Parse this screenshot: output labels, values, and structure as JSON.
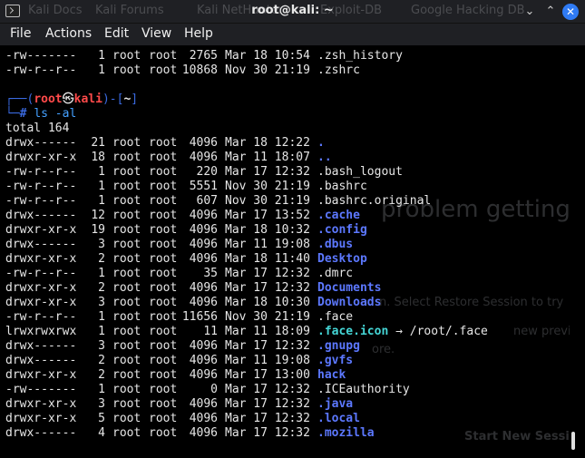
{
  "window": {
    "title": "root@kali: ~",
    "ghost_tabs": [
      "Kali Docs",
      "Kali Forums",
      "Kali NetHunter",
      "Exploit-DB",
      "Google Hacking DB"
    ],
    "controls": {
      "minimize": "⌄",
      "maximize": "⌃",
      "close": "✕"
    }
  },
  "menu": [
    "File",
    "Actions",
    "Edit",
    "View",
    "Help"
  ],
  "ghost_text": {
    "headline": "problem getting you",
    "restore": "n. Select Restore Session to try",
    "previous": "new previous",
    "more": "ore.",
    "start_new": "Start New Session"
  },
  "prev_lines": [
    {
      "perm": "-rw-------",
      "links": "1",
      "owner": "root",
      "group": "root",
      "size": "2765",
      "date": "Mar 18 10:54",
      "name": ".zsh_history",
      "kind": "file"
    },
    {
      "perm": "-rw-r--r--",
      "links": "1",
      "owner": "root",
      "group": "root",
      "size": "10868",
      "date": "Nov 30 21:19",
      "name": ".zshrc",
      "kind": "file"
    }
  ],
  "prompt": {
    "frame_top": "┌──(",
    "user": "root",
    "at": "㉿",
    "host": "kali",
    "mid": ")-[",
    "dir": "~",
    "end": "]",
    "frame_bottom": "└─",
    "hash": "#",
    "command": "ls -al"
  },
  "total": "total 164",
  "entries": [
    {
      "perm": "drwx------",
      "links": "21",
      "owner": "root",
      "group": "root",
      "size": "4096",
      "date": "Mar 18 12:22",
      "name": ".",
      "kind": "dir"
    },
    {
      "perm": "drwxr-xr-x",
      "links": "18",
      "owner": "root",
      "group": "root",
      "size": "4096",
      "date": "Mar 11 18:07",
      "name": "..",
      "kind": "dir"
    },
    {
      "perm": "-rw-r--r--",
      "links": "1",
      "owner": "root",
      "group": "root",
      "size": "220",
      "date": "Mar 17 12:32",
      "name": ".bash_logout",
      "kind": "file"
    },
    {
      "perm": "-rw-r--r--",
      "links": "1",
      "owner": "root",
      "group": "root",
      "size": "5551",
      "date": "Nov 30 21:19",
      "name": ".bashrc",
      "kind": "file"
    },
    {
      "perm": "-rw-r--r--",
      "links": "1",
      "owner": "root",
      "group": "root",
      "size": "607",
      "date": "Nov 30 21:19",
      "name": ".bashrc.original",
      "kind": "file"
    },
    {
      "perm": "drwx------",
      "links": "12",
      "owner": "root",
      "group": "root",
      "size": "4096",
      "date": "Mar 17 13:52",
      "name": ".cache",
      "kind": "dir"
    },
    {
      "perm": "drwxr-xr-x",
      "links": "19",
      "owner": "root",
      "group": "root",
      "size": "4096",
      "date": "Mar 18 10:32",
      "name": ".config",
      "kind": "dir"
    },
    {
      "perm": "drwx------",
      "links": "3",
      "owner": "root",
      "group": "root",
      "size": "4096",
      "date": "Mar 11 19:08",
      "name": ".dbus",
      "kind": "dir"
    },
    {
      "perm": "drwxr-xr-x",
      "links": "2",
      "owner": "root",
      "group": "root",
      "size": "4096",
      "date": "Mar 18 11:40",
      "name": "Desktop",
      "kind": "dir"
    },
    {
      "perm": "-rw-r--r--",
      "links": "1",
      "owner": "root",
      "group": "root",
      "size": "35",
      "date": "Mar 17 12:32",
      "name": ".dmrc",
      "kind": "file"
    },
    {
      "perm": "drwxr-xr-x",
      "links": "2",
      "owner": "root",
      "group": "root",
      "size": "4096",
      "date": "Mar 17 12:32",
      "name": "Documents",
      "kind": "dir"
    },
    {
      "perm": "drwxr-xr-x",
      "links": "3",
      "owner": "root",
      "group": "root",
      "size": "4096",
      "date": "Mar 18 10:30",
      "name": "Downloads",
      "kind": "dir"
    },
    {
      "perm": "-rw-r--r--",
      "links": "1",
      "owner": "root",
      "group": "root",
      "size": "11656",
      "date": "Nov 30 21:19",
      "name": ".face",
      "kind": "file"
    },
    {
      "perm": "lrwxrwxrwx",
      "links": "1",
      "owner": "root",
      "group": "root",
      "size": "11",
      "date": "Mar 11 18:09",
      "name": ".face.icon",
      "target": "→ /root/.face",
      "kind": "link"
    },
    {
      "perm": "drwx------",
      "links": "3",
      "owner": "root",
      "group": "root",
      "size": "4096",
      "date": "Mar 17 12:32",
      "name": ".gnupg",
      "kind": "dir"
    },
    {
      "perm": "drwx------",
      "links": "2",
      "owner": "root",
      "group": "root",
      "size": "4096",
      "date": "Mar 11 19:08",
      "name": ".gvfs",
      "kind": "dir"
    },
    {
      "perm": "drwxr-xr-x",
      "links": "2",
      "owner": "root",
      "group": "root",
      "size": "4096",
      "date": "Mar 17 13:00",
      "name": "hack",
      "kind": "dir"
    },
    {
      "perm": "-rw-------",
      "links": "1",
      "owner": "root",
      "group": "root",
      "size": "0",
      "date": "Mar 17 12:32",
      "name": ".ICEauthority",
      "kind": "file"
    },
    {
      "perm": "drwxr-xr-x",
      "links": "3",
      "owner": "root",
      "group": "root",
      "size": "4096",
      "date": "Mar 17 12:32",
      "name": ".java",
      "kind": "dir"
    },
    {
      "perm": "drwxr-xr-x",
      "links": "5",
      "owner": "root",
      "group": "root",
      "size": "4096",
      "date": "Mar 17 12:32",
      "name": ".local",
      "kind": "dir"
    },
    {
      "perm": "drwx------",
      "links": "4",
      "owner": "root",
      "group": "root",
      "size": "4096",
      "date": "Mar 17 12:32",
      "name": ".mozilla",
      "kind": "dir"
    }
  ]
}
